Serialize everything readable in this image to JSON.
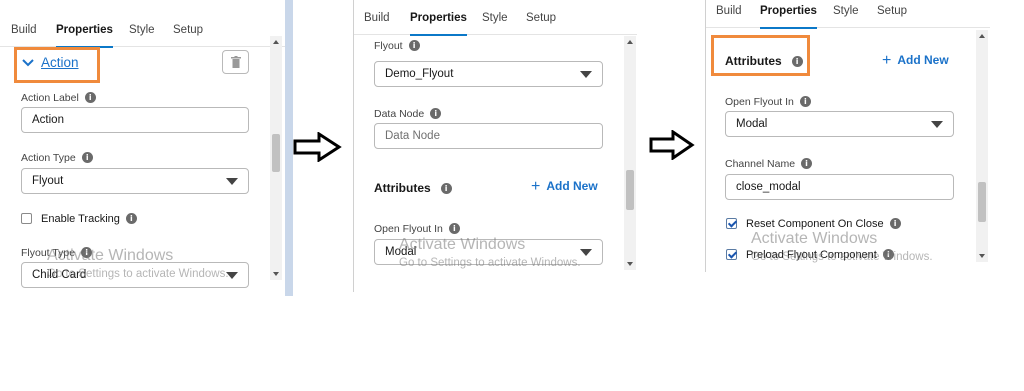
{
  "tabs": [
    "Build",
    "Properties",
    "Style",
    "Setup"
  ],
  "watermark": {
    "title": "Activate Windows",
    "subtitle": "Go to Settings to activate Windows."
  },
  "panel1": {
    "section_label": "Action",
    "action_label": {
      "label": "Action Label",
      "value": "Action"
    },
    "action_type": {
      "label": "Action Type",
      "value": "Flyout"
    },
    "enable_tracking": "Enable Tracking",
    "flyout_type": {
      "label": "Flyout Type",
      "value": "Child Card"
    }
  },
  "panel2": {
    "flyout": {
      "label": "Flyout",
      "value": "Demo_Flyout"
    },
    "data_node": {
      "label": "Data Node",
      "placeholder": "Data Node"
    },
    "attributes_label": "Attributes",
    "add_new_label": "Add New",
    "open_flyout_in": {
      "label": "Open Flyout In",
      "value": "Modal"
    }
  },
  "panel3": {
    "attributes_label": "Attributes",
    "add_new_label": "Add New",
    "open_flyout_in": {
      "label": "Open Flyout In",
      "value": "Modal"
    },
    "channel_name": {
      "label": "Channel Name",
      "value": "close_modal"
    },
    "reset_component": "Reset Component On Close",
    "preload_flyout": "Preload Flyout Component"
  },
  "colors": {
    "accent": "#1b72c9",
    "highlight": "#f08a3c",
    "tab_underline": "#0b78c8"
  },
  "icons": [
    "chevron-down-icon",
    "trash-icon",
    "info-icon",
    "plus-icon",
    "caret-down-icon",
    "right-arrow-icon",
    "checkbox-icon"
  ]
}
